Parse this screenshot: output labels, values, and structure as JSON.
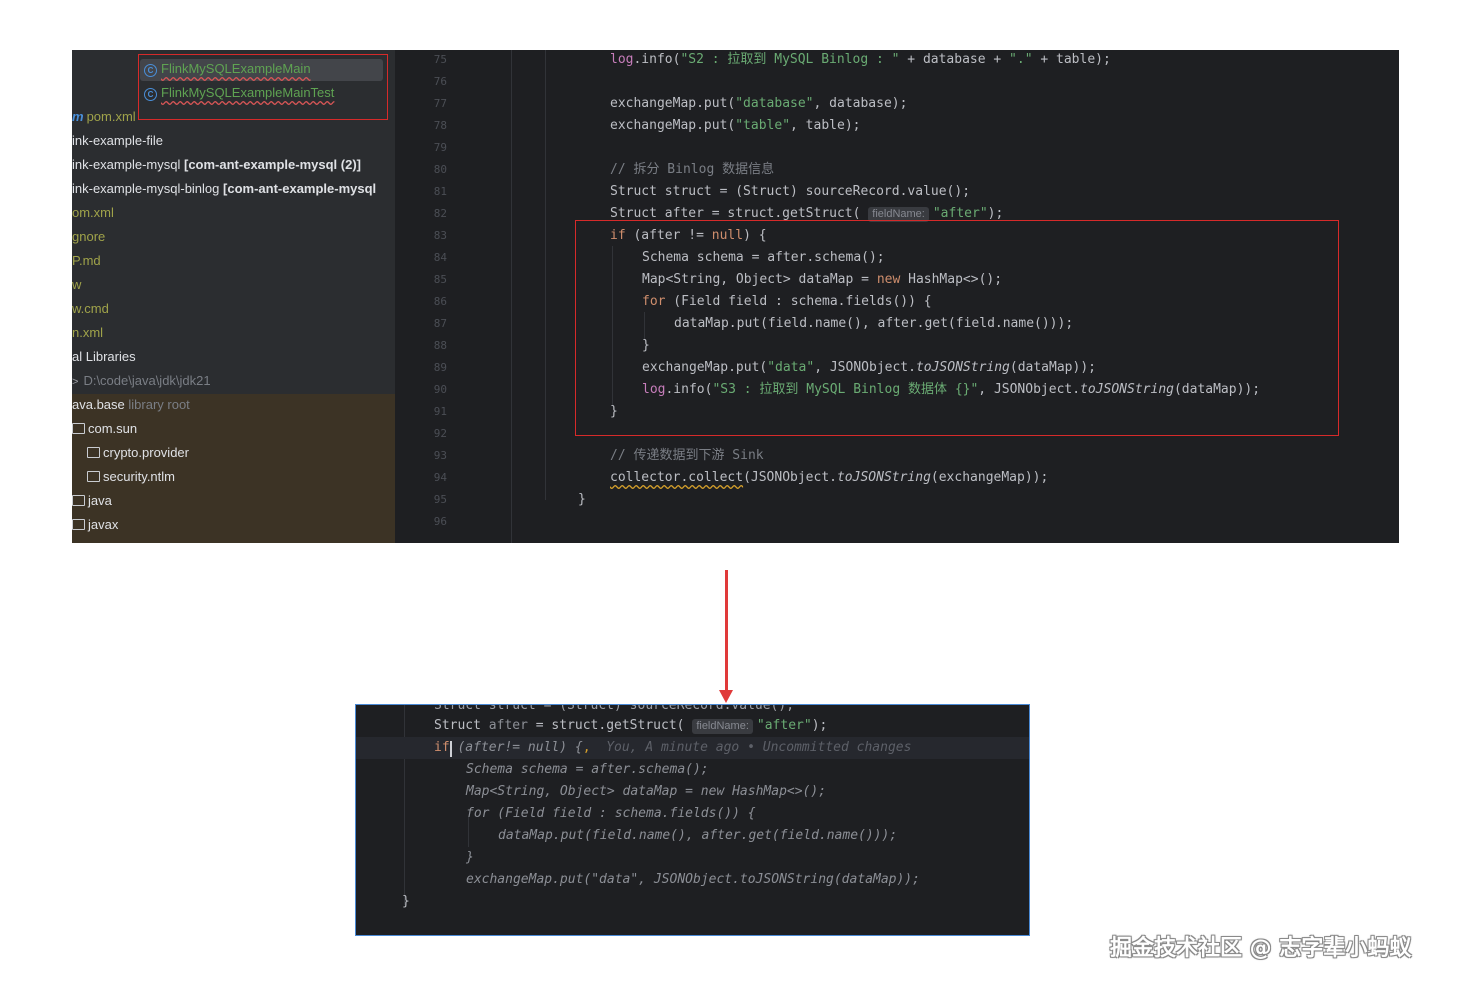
{
  "project_tree": {
    "file_a": "FlinkMySQLExampleMain",
    "file_b": "FlinkMySQLExampleMainTest",
    "rows": [
      {
        "text": "pom.xml"
      },
      {
        "text": "ink-example-file"
      },
      {
        "text": "ink-example-mysql",
        "module": "[com-ant-example-mysql (2)]"
      },
      {
        "text": "ink-example-mysql-binlog",
        "module": "[com-ant-example-mysql"
      },
      {
        "text": "om.xml"
      },
      {
        "text": "gnore"
      },
      {
        "text": "P.md"
      },
      {
        "text": "w"
      },
      {
        "text": "w.cmd"
      },
      {
        "text": "n.xml"
      },
      {
        "text": "al Libraries"
      },
      {
        "text": "D:\\code\\java\\jdk\\jdk21"
      },
      {
        "text": "ava.base",
        "suffix": "library root"
      },
      {
        "text": "com.sun"
      },
      {
        "text": "crypto.provider"
      },
      {
        "text": "security.ntlm"
      },
      {
        "text": "java"
      },
      {
        "text": "javax"
      }
    ]
  },
  "editor": {
    "line_numbers": [
      "75",
      "76",
      "77",
      "78",
      "79",
      "80",
      "81",
      "82",
      "83",
      "84",
      "85",
      "86",
      "87",
      "88",
      "89",
      "90",
      "91",
      "92",
      "93",
      "94",
      "95",
      "96"
    ],
    "hint_label": "fieldName:",
    "comment_split": "// 拆分 Binlog 数据信息",
    "comment_send": "// 传递数据到下游 Sink",
    "log_s2": "\"S2 : 拉取到 MySQL Binlog : \"",
    "log_s3": "\"S3 : 拉取到 MySQL Binlog 数据体 {}\"",
    "str_database": "\"database\"",
    "str_table": "\"table\"",
    "str_dot": "\".\"",
    "str_after": "\"after\"",
    "str_data": "\"data\""
  },
  "bottom_editor": {
    "blame": "You, A minute ago • Uncommitted changes"
  },
  "watermark": "掘金技术社区 @ 志字辈小蚂蚁"
}
